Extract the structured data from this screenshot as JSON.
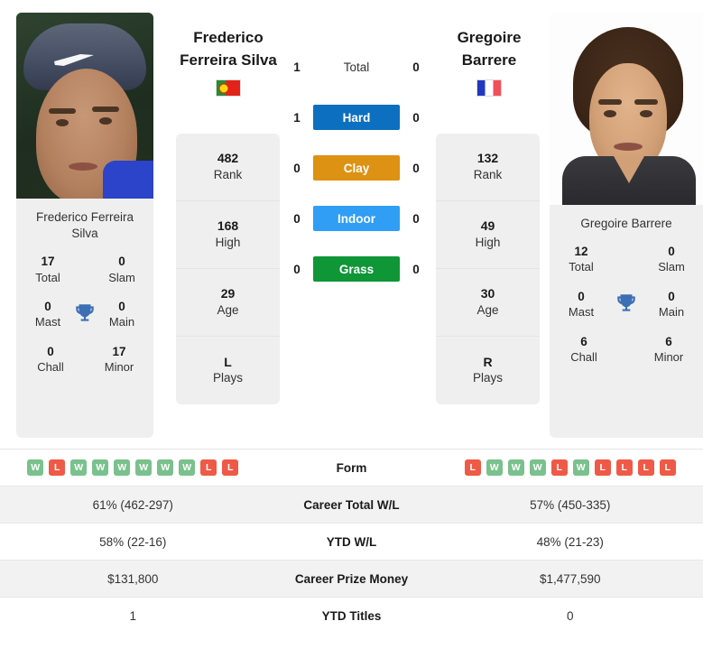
{
  "players": {
    "left": {
      "first_name": "Frederico",
      "last_name": "Ferreira Silva",
      "full_name": "Frederico Ferreira Silva",
      "flag": "flag-portugal",
      "stats": [
        {
          "value": "482",
          "label": "Rank"
        },
        {
          "value": "168",
          "label": "High"
        },
        {
          "value": "29",
          "label": "Age"
        },
        {
          "value": "L",
          "label": "Plays"
        }
      ],
      "titles": {
        "total": "17",
        "slam": "0",
        "mast": "0",
        "main": "0",
        "chall": "0",
        "minor": "17",
        "total_label": "Total",
        "slam_label": "Slam",
        "mast_label": "Mast",
        "main_label": "Main",
        "chall_label": "Chall",
        "minor_label": "Minor"
      },
      "form": [
        "W",
        "L",
        "W",
        "W",
        "W",
        "W",
        "W",
        "W",
        "L",
        "L"
      ],
      "career_wl": "61% (462-297)",
      "ytd_wl": "58% (22-16)",
      "prize_money": "$131,800",
      "ytd_titles": "1"
    },
    "right": {
      "first_name": "Gregoire",
      "last_name": "Barrere",
      "full_name": "Gregoire Barrere",
      "flag": "flag-france",
      "stats": [
        {
          "value": "132",
          "label": "Rank"
        },
        {
          "value": "49",
          "label": "High"
        },
        {
          "value": "30",
          "label": "Age"
        },
        {
          "value": "R",
          "label": "Plays"
        }
      ],
      "titles": {
        "total": "12",
        "slam": "0",
        "mast": "0",
        "main": "0",
        "chall": "6",
        "minor": "6",
        "total_label": "Total",
        "slam_label": "Slam",
        "mast_label": "Mast",
        "main_label": "Main",
        "chall_label": "Chall",
        "minor_label": "Minor"
      },
      "form": [
        "L",
        "W",
        "W",
        "W",
        "L",
        "W",
        "L",
        "L",
        "L",
        "L"
      ],
      "career_wl": "57% (450-335)",
      "ytd_wl": "48% (21-23)",
      "prize_money": "$1,477,590",
      "ytd_titles": "0"
    }
  },
  "head_to_head": [
    {
      "label": "Total",
      "left": "1",
      "right": "0",
      "color": "",
      "plain": true
    },
    {
      "label": "Hard",
      "left": "1",
      "right": "0",
      "color": "#0d6fbf",
      "plain": false
    },
    {
      "label": "Clay",
      "left": "0",
      "right": "0",
      "color": "#dd9213",
      "plain": false
    },
    {
      "label": "Indoor",
      "left": "0",
      "right": "0",
      "color": "#2f9ef4",
      "plain": false
    },
    {
      "label": "Grass",
      "left": "0",
      "right": "0",
      "color": "#0e9637",
      "plain": false
    }
  ],
  "table_rows": [
    {
      "label": "Form",
      "type": "form",
      "shaded": false
    },
    {
      "label": "Career Total W/L",
      "type": "text",
      "shaded": true,
      "key": "career_wl"
    },
    {
      "label": "YTD W/L",
      "type": "text",
      "shaded": false,
      "key": "ytd_wl"
    },
    {
      "label": "Career Prize Money",
      "type": "text",
      "shaded": true,
      "key": "prize_money"
    },
    {
      "label": "YTD Titles",
      "type": "text",
      "shaded": false,
      "key": "ytd_titles"
    }
  ],
  "colors": {
    "win_badge": "#7ac18d",
    "loss_badge": "#ee5a47",
    "trophy": "#3d6fb4",
    "card_bg": "#efefef",
    "row_shade": "#f2f2f2"
  }
}
